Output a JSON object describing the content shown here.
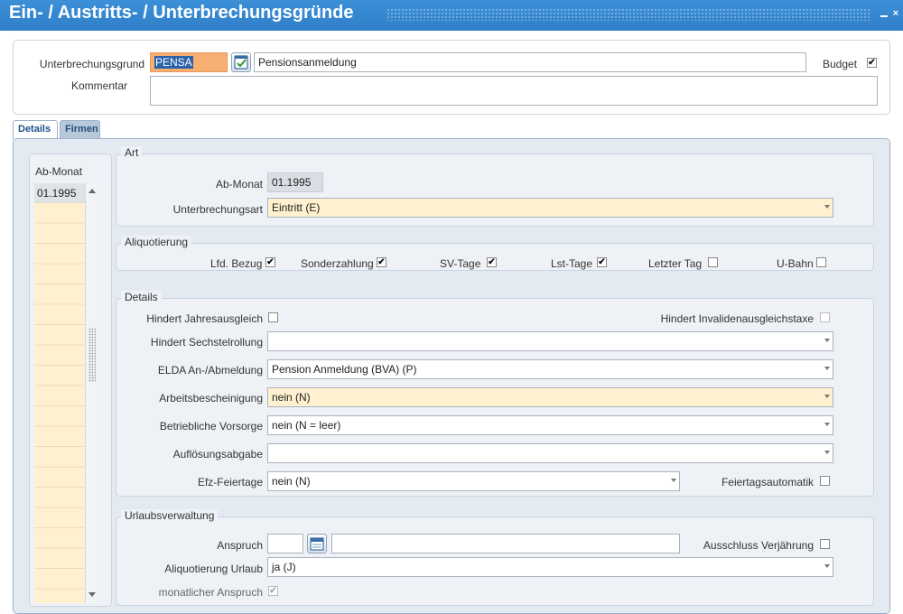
{
  "window": {
    "title": "Ein- / Austritts- / Unterbrechungsgründe"
  },
  "header": {
    "grund_label": "Unterbrechungsgrund",
    "grund_code": "PENSA",
    "grund_text": "Pensionsanmeldung",
    "budget_label": "Budget",
    "budget_checked": true,
    "kommentar_label": "Kommentar",
    "kommentar_value": ""
  },
  "tabs": [
    {
      "label": "Details",
      "active": true
    },
    {
      "label": "Firmen",
      "active": false
    }
  ],
  "list": {
    "header": "Ab-Monat",
    "items": [
      "01.1995"
    ]
  },
  "art": {
    "legend": "Art",
    "ab_monat_label": "Ab-Monat",
    "ab_monat_value": "01.1995",
    "unterbrechungsart_label": "Unterbrechungsart",
    "unterbrechungsart_value": "Eintritt (E)"
  },
  "aliquotierung": {
    "legend": "Aliquotierung",
    "items": [
      {
        "label": "Lfd. Bezug",
        "checked": true
      },
      {
        "label": "Sonderzahlung",
        "checked": true
      },
      {
        "label": "SV-Tage",
        "checked": true
      },
      {
        "label": "Lst-Tage",
        "checked": true
      },
      {
        "label": "Letzter Tag",
        "checked": false
      },
      {
        "label": "U-Bahn",
        "checked": false
      }
    ]
  },
  "details": {
    "legend": "Details",
    "jahresausgleich_label": "Hindert Jahresausgleich",
    "invaliden_label": "Hindert Invalidenausgleichstaxe",
    "sechstel_label": "Hindert Sechstelrollung",
    "sechstel_value": "",
    "elda_label": "ELDA An-/Abmeldung",
    "elda_value": "Pension Anmeldung (BVA) (P)",
    "arbeit_label": "Arbeitsbescheinigung",
    "arbeit_value": "nein (N)",
    "vorsorge_label": "Betriebliche Vorsorge",
    "vorsorge_value": "nein (N = leer)",
    "aufloesung_label": "Auflösungsabgabe",
    "aufloesung_value": "",
    "efz_label": "Efz-Feiertage",
    "efz_value": "nein (N)",
    "feiertag_label": "Feiertagsautomatik"
  },
  "urlaub": {
    "legend": "Urlaubsverwaltung",
    "anspruch_label": "Anspruch",
    "anspruch_value": "",
    "anspruch_text": "",
    "ausschluss_label": "Ausschluss Verjährung",
    "aliq_label": "Aliquotierung Urlaub",
    "aliq_value": "ja (J)",
    "monatlich_label": "monatlicher Anspruch",
    "monatlich_checked": true
  },
  "colors": {
    "titlebar": "#3c90d8",
    "field_yellow": "#fff1cf",
    "field_orange": "#f7b071",
    "panel_bg": "#eef2f6"
  }
}
